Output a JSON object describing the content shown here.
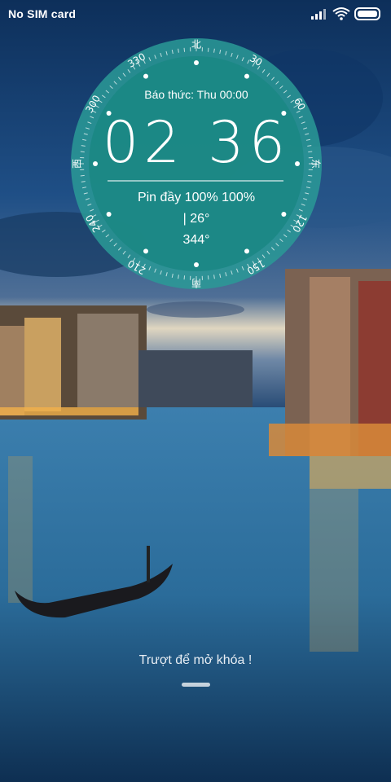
{
  "status_bar": {
    "carrier": "No SIM card",
    "icons": [
      "signal-icon",
      "wifi-icon",
      "battery-icon"
    ]
  },
  "clock": {
    "alarm": "Báo thức: Thu 00:00",
    "hour": "02",
    "minute": "36",
    "battery": "Pin đầy 100% 100%",
    "temperature": "| 26°",
    "heading": "344°",
    "compass_labels": [
      "北",
      "30",
      "60",
      "东",
      "120",
      "150",
      "南",
      "210",
      "240",
      "西",
      "300",
      "330"
    ],
    "colors": {
      "dial": "#1a8c8c",
      "ring": "#3aa8a4"
    }
  },
  "lock": {
    "hint": "Trượt để mở khóa !"
  }
}
